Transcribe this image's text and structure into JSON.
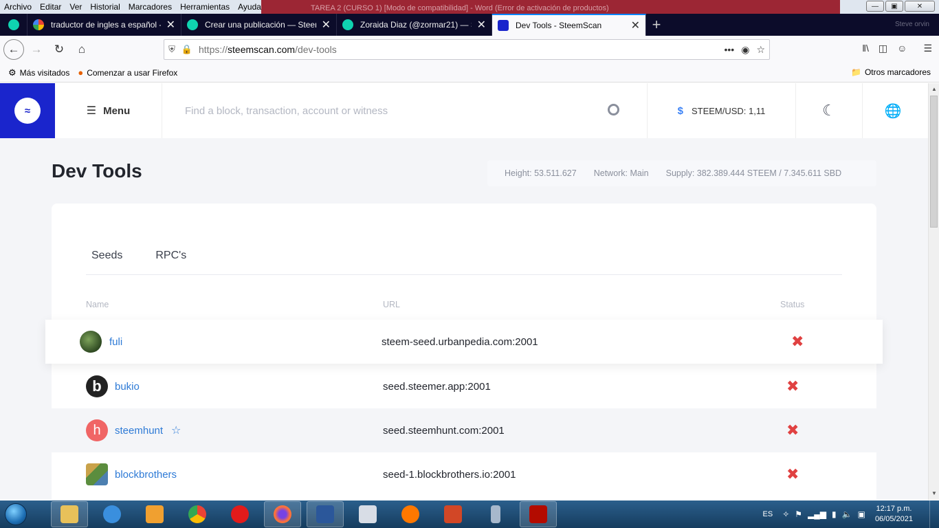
{
  "menubar": [
    "Archivo",
    "Editar",
    "Ver",
    "Historial",
    "Marcadores",
    "Herramientas",
    "Ayuda"
  ],
  "titlebar_text": "TAREA 2 (CURSO 1) [Modo de compatibilidad] - Word (Error de activación de productos)",
  "tabs": [
    {
      "title": "traductor de ingles a español -",
      "favicon": "google-icon",
      "active": false
    },
    {
      "title": "Crear una publicación — Steem",
      "favicon": "steemit-icon",
      "active": false
    },
    {
      "title": "Zoraida Diaz (@zormar21) — St",
      "favicon": "steemit-icon",
      "active": false
    },
    {
      "title": "Dev Tools - SteemScan",
      "favicon": "steemscan-icon",
      "active": true
    }
  ],
  "tab_right_text": "Steve orvin",
  "url": {
    "scheme": "https://",
    "domain": "steemscan.com",
    "path": "/dev-tools"
  },
  "bookmarks": [
    {
      "label": "Más visitados",
      "icon": "gear-icon"
    },
    {
      "label": "Comenzar a usar Firefox",
      "icon": "firefox-icon"
    }
  ],
  "bookmarks_other": "Otros marcadores",
  "header": {
    "menu_label": "Menu",
    "search_placeholder": "Find a block, transaction, account or witness",
    "price": "STEEM/USD: 1,11"
  },
  "page_title": "Dev Tools",
  "stats": {
    "height": "Height: 53.511.627",
    "network": "Network: Main",
    "supply": "Supply: 382.389.444 STEEM / 7.345.611 SBD"
  },
  "card_tabs": [
    "Seeds",
    "RPC's"
  ],
  "columns": {
    "name": "Name",
    "url": "URL",
    "status": "Status"
  },
  "rows": [
    {
      "name": "fuli",
      "url": "steem-seed.urbanpedia.com:2001",
      "status": "offline",
      "avatar_color": "#3c5a2e"
    },
    {
      "name": "bukio",
      "url": "seed.steemer.app:2001",
      "status": "offline",
      "avatar_color": "#222222"
    },
    {
      "name": "steemhunt",
      "url": "seed.steemhunt.com:2001",
      "status": "offline",
      "avatar_color": "#f06565"
    },
    {
      "name": "blockbrothers",
      "url": "seed-1.blockbrothers.io:2001",
      "status": "offline",
      "avatar_color": "#6c8a4a"
    }
  ],
  "taskbar": {
    "lang": "ES",
    "time": "12:17 p.m.",
    "date": "06/05/2021"
  }
}
